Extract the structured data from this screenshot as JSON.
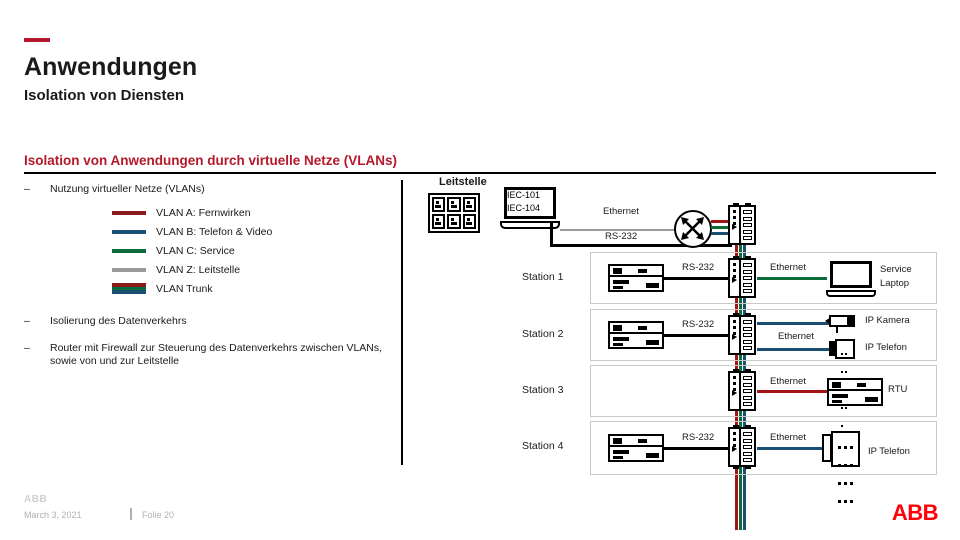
{
  "header": {
    "accent_color": "#b5182b",
    "title": "Anwendungen",
    "subtitle": "Isolation von Diensten",
    "section_heading": "Isolation von Anwendungen durch virtuelle Netze (VLANs)"
  },
  "left": {
    "bullet1": "Nutzung virtueller Netze (VLANs)",
    "bullet2": "Isolierung des Datenverkehrs",
    "bullet3": "Router mit Firewall zur Steuerung des Datenverkehrs zwischen VLANs, sowie von und zur Leitstelle",
    "dash": "–",
    "legend": [
      {
        "label": "VLAN A: Fernwirken",
        "color": "#8c1919",
        "type": "line"
      },
      {
        "label": "VLAN B: Telefon & Video",
        "color": "#1a4f73",
        "type": "line"
      },
      {
        "label": "VLAN C: Service",
        "color": "#0b6b3a",
        "type": "line"
      },
      {
        "label": "VLAN Z: Leitstelle",
        "color": "#9a9a9a",
        "type": "line"
      },
      {
        "label": "VLAN Trunk",
        "colors": [
          "#8c1919",
          "#0b6b3a",
          "#1a4f73"
        ],
        "type": "trunk"
      }
    ]
  },
  "diagram": {
    "control_center": {
      "label": "Leitstelle",
      "rack_name": "server-rack",
      "workstation_line1": "IEC-101",
      "workstation_line2": "IEC-104",
      "link_ethernet": "Ethernet",
      "link_rs232": "RS-232",
      "router_name": "router-firewall",
      "switch_name": "network-switch"
    },
    "stations": [
      {
        "name": "Station 1",
        "left_device": "rtu",
        "left_link": "RS-232",
        "right_link": "Ethernet",
        "right_link_color": "#0b6b3a",
        "endpoints": [
          {
            "label": "Service\nLaptop",
            "icon": "laptop-icon"
          }
        ]
      },
      {
        "name": "Station 2",
        "left_device": "rtu",
        "left_link": "RS-232",
        "right_link": "Ethernet",
        "right_link_color": "#1a4f73",
        "endpoints": [
          {
            "label": "IP Kamera",
            "icon": "ip-camera-icon"
          },
          {
            "label": "IP Telefon",
            "icon": "ip-phone-icon"
          }
        ]
      },
      {
        "name": "Station 3",
        "left_device": null,
        "left_link": null,
        "right_link": "Ethernet",
        "right_link_color": "#a51414",
        "endpoints": [
          {
            "label": "RTU",
            "icon": "rtu-icon"
          }
        ]
      },
      {
        "name": "Station 4",
        "left_device": "rtu",
        "left_link": "RS-232",
        "right_link": "Ethernet",
        "right_link_color": "#1a4f73",
        "endpoints": [
          {
            "label": "IP Telefon",
            "icon": "ip-phone-large-icon"
          }
        ]
      }
    ],
    "trunk_colors": [
      "#a51414",
      "#0b6b3a",
      "#1a4f73"
    ]
  },
  "footer": {
    "watermark": "ABB",
    "date": "March 3, 2021",
    "slide": "Folie 20",
    "logo": "ABB",
    "logo_color": "#ff000a"
  }
}
